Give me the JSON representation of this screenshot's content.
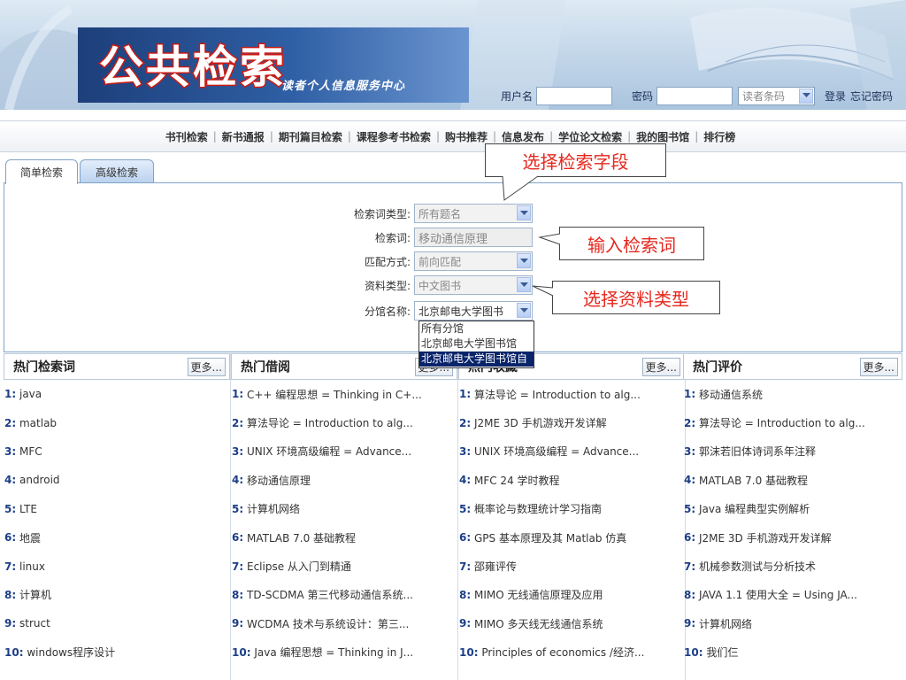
{
  "header": {
    "logo_title": "公共检索",
    "logo_subtitle": "读者个人信息服务中心",
    "username_label": "用户名",
    "password_label": "密码",
    "login_type": "读者条码",
    "login_link": "登录",
    "forgot_link": "忘记密码"
  },
  "nav": {
    "items": [
      "书刊检索",
      "新书通报",
      "期刊篇目检索",
      "课程参考书检索",
      "购书推荐",
      "信息发布",
      "学位论文检索",
      "我的图书馆",
      "排行榜"
    ]
  },
  "tabs": [
    "简单检索",
    "高级检索"
  ],
  "form": {
    "keyword_type_label": "检索词类型:",
    "keyword_type_value": "所有题名",
    "keyword_label": "检索词:",
    "keyword_value": "移动通信原理",
    "match_label": "匹配方式:",
    "match_value": "前向匹配",
    "material_label": "资料类型:",
    "material_value": "中文图书",
    "branch_label": "分馆名称:",
    "branch_value": "北京邮电大学图书",
    "branch_options": [
      "所有分馆",
      "北京邮电大学图书馆",
      "北京邮电大学图书馆自"
    ]
  },
  "callouts": {
    "field": "选择检索字段",
    "keyword": "输入检索词",
    "material": "选择资料类型"
  },
  "colors": {
    "callout_text": "#e5271e",
    "logo_stroke": "#cc1b14",
    "list_number": "#1c3f86",
    "dropdown_selected": "#0a246a"
  },
  "columns": [
    {
      "title": "热门检索词",
      "more": "更多...",
      "items": [
        "java",
        "matlab",
        "MFC",
        "android",
        "LTE",
        "地震",
        "linux",
        "计算机",
        "struct",
        "windows程序设计"
      ]
    },
    {
      "title": "热门借阅",
      "more": "更多...",
      "items": [
        "C++ 编程思想 = Thinking in C+...",
        "算法导论 = Introduction to alg...",
        "UNIX 环境高级编程 = Advance...",
        "移动通信原理",
        "计算机网络",
        "MATLAB 7.0 基础教程",
        "Eclipse 从入门到精通",
        "TD-SCDMA 第三代移动通信系统...",
        "WCDMA 技术与系统设计：第三...",
        "Java 编程思想 = Thinking in J..."
      ]
    },
    {
      "title": "热门收藏",
      "more": "更多...",
      "items": [
        "算法导论 = Introduction to alg...",
        "J2ME 3D 手机游戏开发详解",
        "UNIX 环境高级编程 = Advance...",
        "MFC 24 学时教程",
        "概率论与数理统计学习指南",
        "GPS 基本原理及其 Matlab 仿真",
        "邵雍评传",
        "MIMO 无线通信原理及应用",
        "MIMO 多天线无线通信系统",
        "Principles of economics /经济..."
      ]
    },
    {
      "title": "热门评价",
      "more": "更多...",
      "items": [
        "移动通信系统",
        "算法导论 = Introduction to alg...",
        "郭沫若旧体诗词系年注释",
        "MATLAB 7.0 基础教程",
        "Java 编程典型实例解析",
        "J2ME 3D 手机游戏开发详解",
        "机械参数测试与分析技术",
        "JAVA 1.1 使用大全 = Using JA...",
        "计算机网络",
        "我们仨"
      ]
    }
  ]
}
